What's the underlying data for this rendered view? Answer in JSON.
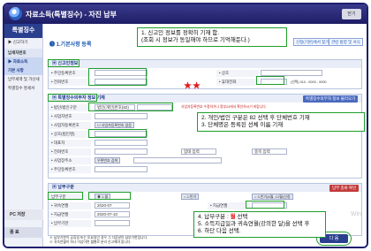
{
  "window": {
    "title": "자료소득(특별징수) - 자진 납부",
    "close_label": "닫기"
  },
  "sidebar": {
    "heading": "특별징수",
    "items": [
      {
        "label": "▶ 신고하기",
        "style": "normal"
      },
      {
        "label": "납세자번호",
        "style": "sec"
      },
      {
        "label": "▶ 자료소득",
        "style": "hl"
      },
      {
        "label": "기본 사항",
        "style": "hl"
      },
      {
        "label": "납부세액 및 가산세",
        "style": "normal"
      },
      {
        "label": "특별징수 명세서",
        "style": "normal"
      }
    ],
    "pc_label": "PC 저장",
    "exit_label": "종 료"
  },
  "content": {
    "step_label": "❶ 1.기본사항 등록",
    "top_buttons": [
      "신청(기본)에서 찾기",
      "관련 법령 및 서식"
    ],
    "section_report": {
      "title": "▣ 신고인정보",
      "rows": [
        {
          "label": "• 주민등록번호",
          "value": ""
        },
        {
          "label": "• 전화번호",
          "value": ""
        }
      ],
      "right_labels": [
        "• 상호",
        "• 휴대전화"
      ],
      "right_hint": "(선택) 010 - 0000 - 0000"
    },
    "section_withholding": {
      "title": "▣ 특별징수의무자 정보 기재",
      "badge": "특별징수의무자 정보 불러오기",
      "rows": [
        {
          "label": "• 법인/법인구분",
          "value": "법인(개인)번호(82)"
        },
        {
          "label": "• 사업자번호",
          "value": ""
        },
        {
          "label": "• 사업자등록번호",
          "value": ""
        },
        {
          "label": "• 상호(법인명)",
          "value": ""
        },
        {
          "label": "• 대표자",
          "value": ""
        },
        {
          "label": "• 전화번호",
          "value": ""
        },
        {
          "label": "• 사업장주소",
          "value": "우편번호 검색"
        },
        {
          "label": "• 주민등록번호",
          "value": ""
        }
      ],
      "checkbox_label": "사업자등록번호 없음",
      "note_red": "사업자등록번호 수정하거나 정부24에서 확인하시기 바랍니다.",
      "right_fields": [
        "업태 입력",
        "종목 입력"
      ]
    },
    "section_payment": {
      "title": "▣ 납부구분",
      "badge": "납부 종류 확인",
      "options": [
        "납부구분",
        "1.월",
        "2.반기",
        "3.반기(6월, 12월)신청"
      ],
      "rows": [
        {
          "label": "• 귀속연월",
          "value": "2020-07"
        },
        {
          "label": "• 지급연월",
          "value": "2020-07-10"
        },
        {
          "label": "• 납부기한",
          "value": ""
        }
      ],
      "right_labels": [
        "• 지급연월",
        "• 신고기한",
        "• 지방소득세"
      ],
      "notes": [
        "※ 납부기한이 공휴일 또는 토요일인 경우 그 다음날이 납부기한입니다.",
        "※ 귀속연월이 하나 이상이면 월별로 분리 신고해야 합니다.",
        "※ 특별징수분 납부는 납부서를 통해서만 가능합니다."
      ],
      "next_label": "다 음"
    }
  },
  "callouts": {
    "c1": [
      "1. 신고인 정보를 정확히 기재 함.",
      "(조회 시 정보가 동일해야 하므로 기억해둔다.)"
    ],
    "c2": [
      "2. 개인/법인 구분은 82 선택 후 단체번호 기재",
      "3. 단체명은 등록된 선체 이름 기재"
    ],
    "c3_prefix": "4. 납부구분 : ",
    "c3_highlight": "월",
    "c3_suffix": " 선택",
    "c3_rest": [
      "5. 소득지급일과 귀속연월(강의한 달)을 선택 후",
      "6. 하단 다음 선택."
    ]
  },
  "stars": "★★",
  "watermark": "Win"
}
